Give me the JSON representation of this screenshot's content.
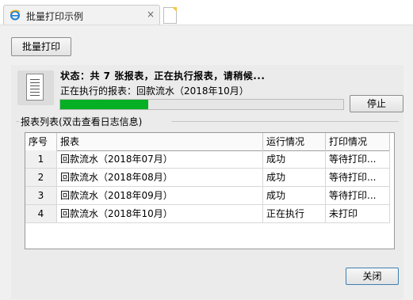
{
  "tab": {
    "title": "批量打印示例",
    "close": "×"
  },
  "toolbar": {
    "batch_print_label": "批量打印"
  },
  "status": {
    "summary": "状态：共 7 张报表，正在执行报表，请稍候...",
    "executing": "正在执行的报表：回款流水（2018年10月）",
    "progress": 0.31,
    "stop_label": "停止"
  },
  "list": {
    "label": "报表列表(双击查看日志信息)",
    "columns": [
      "序号",
      "报表",
      "运行情况",
      "打印情况"
    ],
    "rows": [
      [
        "1",
        "回款流水（2018年07月）",
        "成功",
        "等待打印..."
      ],
      [
        "2",
        "回款流水（2018年08月）",
        "成功",
        "等待打印..."
      ],
      [
        "3",
        "回款流水（2018年09月）",
        "成功",
        "等待打印..."
      ],
      [
        "4",
        "回款流水（2018年10月）",
        "正在执行",
        "未打印"
      ]
    ]
  },
  "footer": {
    "close_label": "关闭"
  },
  "icons": {
    "tab": "ie-page-icon",
    "new_tab": "new-tab-icon",
    "report": "report-document-icon"
  },
  "colors": {
    "progress": "#06b025"
  }
}
